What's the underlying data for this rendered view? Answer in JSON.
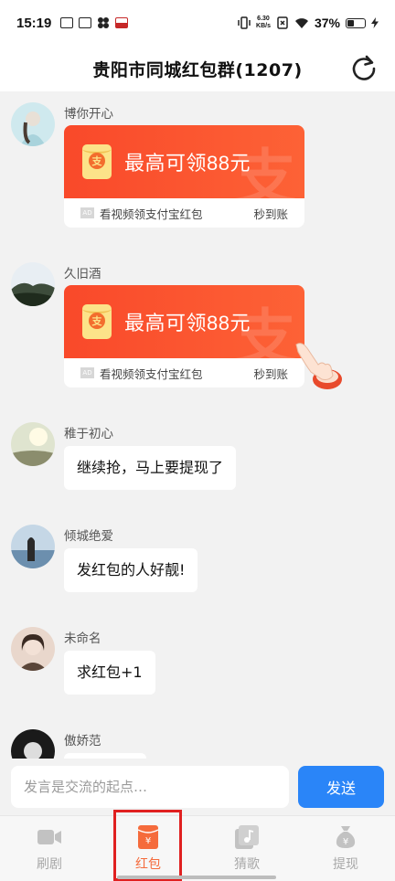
{
  "status_bar": {
    "time": "15:19",
    "net_speed_value": "6.30",
    "net_speed_unit": "KB/s",
    "battery": "37%"
  },
  "header": {
    "title": "贵阳市同城红包群(1207)"
  },
  "messages": [
    {
      "user": "博你开心",
      "type": "red_packet",
      "title": "最高可领88元",
      "watermark": "支",
      "footer_left": "看视频领支付宝红包",
      "footer_right": "秒到账",
      "ad_tag": "AD"
    },
    {
      "user": "久旧酒",
      "type": "red_packet",
      "title": "最高可领88元",
      "watermark": "支",
      "footer_left": "看视频领支付宝红包",
      "footer_right": "秒到账",
      "ad_tag": "AD"
    },
    {
      "user": "稚于初心",
      "type": "text",
      "text": "继续抢，马上要提现了"
    },
    {
      "user": "倾城绝爱",
      "type": "text",
      "text": "发红包的人好靓!"
    },
    {
      "user": "未命名",
      "type": "text",
      "text": "求红包+1"
    },
    {
      "user": "傲娇范",
      "type": "text",
      "text": ""
    }
  ],
  "input": {
    "placeholder": "发言是交流的起点…",
    "send_label": "发送"
  },
  "tabs": [
    {
      "label": "刷剧",
      "icon": "video-icon",
      "active": false
    },
    {
      "label": "红包",
      "icon": "red-packet-icon",
      "active": true
    },
    {
      "label": "猜歌",
      "icon": "music-icon",
      "active": false
    },
    {
      "label": "提现",
      "icon": "money-bag-icon",
      "active": false
    }
  ],
  "colors": {
    "red_packet": "#f9492a",
    "send_button": "#2a85f8",
    "active_tab": "#f56b3c",
    "highlight": "#e02020"
  }
}
